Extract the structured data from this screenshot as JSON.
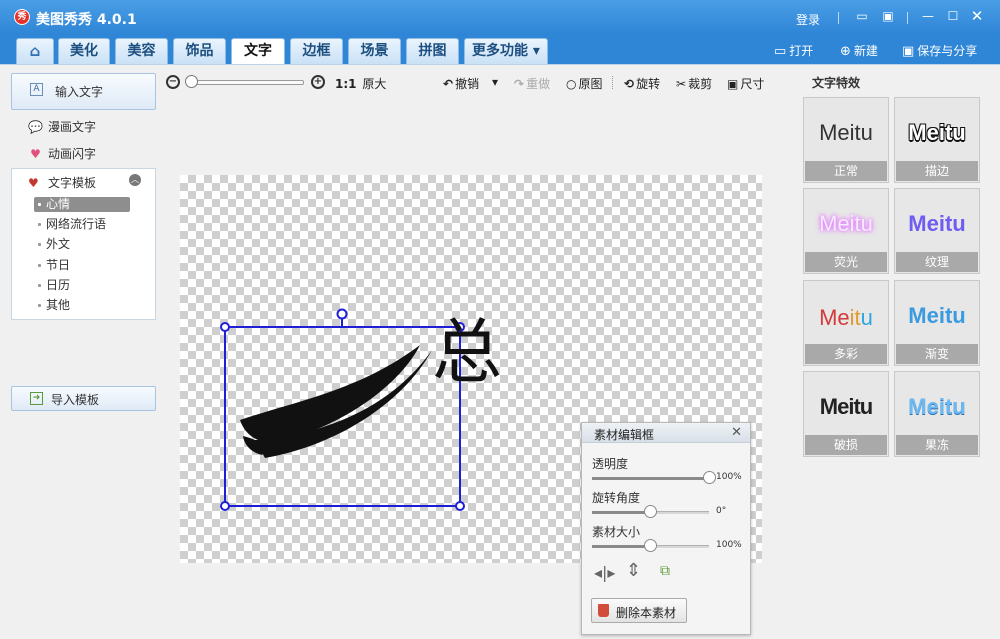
{
  "window": {
    "title": "美图秀秀 4.0.1",
    "logo_text": "秀",
    "login": "登录"
  },
  "tabs": [
    {
      "label": "美化"
    },
    {
      "label": "美容"
    },
    {
      "label": "饰品"
    },
    {
      "label": "文字",
      "active": true
    },
    {
      "label": "边框"
    },
    {
      "label": "场景"
    },
    {
      "label": "拼图"
    },
    {
      "label": "更多功能 ▾"
    }
  ],
  "actions": {
    "open": "打开",
    "new": "新建",
    "save_share": "保存与分享"
  },
  "sidebar": {
    "input_text": "输入文字",
    "comic_text": "漫画文字",
    "animated_text": "动画闪字",
    "templates_header": "文字模板",
    "template_items": [
      "心情",
      "网络流行语",
      "外文",
      "节日",
      "日历",
      "其他"
    ],
    "selected_template": "心情",
    "import_template": "导入模板"
  },
  "toolbar": {
    "ratio_label": "1:1",
    "original_size": "原大",
    "undo": "撤销",
    "redo": "重做",
    "original_image": "原图",
    "rotate": "旋转",
    "crop": "裁剪",
    "size": "尺寸"
  },
  "canvas": {
    "text_char": "总"
  },
  "effects": {
    "title": "文字特效",
    "sample_text": "Meitu",
    "items": [
      {
        "name": "正常",
        "color": "#333333"
      },
      {
        "name": "描边",
        "color": "#ffffff"
      },
      {
        "name": "荧光",
        "color": "#f7d7ff"
      },
      {
        "name": "纹理",
        "color": "#6f5cf0"
      },
      {
        "name": "多彩",
        "color": "#d43a3a"
      },
      {
        "name": "渐变",
        "color": "#3a9be0"
      },
      {
        "name": "破损",
        "color": "#222222"
      },
      {
        "name": "果冻",
        "color": "#6cb8f0"
      }
    ]
  },
  "editor": {
    "title": "素材编辑框",
    "opacity_label": "透明度",
    "opacity_value": "100%",
    "opacity": 1.0,
    "rotation_label": "旋转角度",
    "rotation_value": "0°",
    "rotation": 0.5,
    "size_label": "素材大小",
    "size_value": "100%",
    "size": 0.5,
    "delete_button": "删除本素材"
  },
  "colors": {
    "accent": "#2f86d6",
    "selection": "#1f1fd6"
  }
}
